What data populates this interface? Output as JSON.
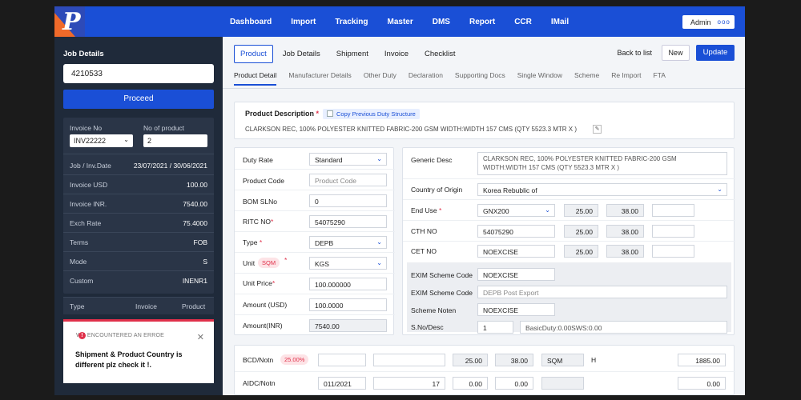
{
  "app": {
    "logo_letter": "P"
  },
  "nav": {
    "items": [
      "Dashboard",
      "Import",
      "Tracking",
      "Master",
      "DMS",
      "Report",
      "CCR",
      "IMail"
    ],
    "admin": "Admin",
    "admin_dots": "ooo"
  },
  "sidebar": {
    "title": "Job Details",
    "job_no": "4210533",
    "proceed": "Proceed",
    "invoice_no_label": "Invoice No",
    "no_of_product_label": "No of product",
    "invoice_no": "INV22222",
    "no_of_product": "2",
    "rows": [
      {
        "label": "Job / Inv.Date",
        "value": "23/07/2021  /  30/06/2021"
      },
      {
        "label": "Invoice  USD",
        "value": "100.00"
      },
      {
        "label": "Invoice INR.",
        "value": "7540.00"
      },
      {
        "label": "Exch Rate",
        "value": "75.4000"
      },
      {
        "label": "Terms",
        "value": "FOB"
      },
      {
        "label": "Mode",
        "value": "S"
      },
      {
        "label": "Custom",
        "value": "INENR1"
      }
    ],
    "type_headers": [
      "Type",
      "Invoice",
      "Product"
    ],
    "alert": {
      "title": "WE ENCOUNTERED AN ERROE",
      "message": "Shipment & Product Country is different plz check it !.",
      "icon": "!",
      "close": "✕"
    }
  },
  "tabs": [
    "Product",
    "Job Details",
    "Shipment",
    "Invoice",
    "Checklist"
  ],
  "actions": {
    "back": "Back to list",
    "new": "New",
    "update": "Update"
  },
  "subtabs": [
    "Product Detail",
    "Manufacturer Details",
    "Other Duty",
    "Declaration",
    "Supporting Docs",
    "Single Window",
    "Scheme",
    "Re Import",
    "FTA"
  ],
  "product": {
    "desc_label": "Product Description",
    "copy_label": "Copy Previous Duty Structure",
    "desc_text": "CLARKSON REC, 100% POLYESTER KNITTED FABRIC-200 GSM WIDTH:WIDTH 157 CMS (QTY 5523.3 MTR X )",
    "edit_icon": "✎"
  },
  "left_form": {
    "duty_rate_label": "Duty Rate",
    "duty_rate": "Standard",
    "product_code_label": "Product Code",
    "product_code_ph": "Product Code",
    "bom_label": "BOM SLNo",
    "bom": "0",
    "ritc_label": "RITC NO",
    "ritc": "54075290",
    "type_label": "Type",
    "type": "DEPB",
    "unit_label": "Unit",
    "unit_badge": "SQM",
    "unit": "KGS",
    "unit_price_label": "Unit Price",
    "unit_price": "100.000000",
    "amount_usd_label": "Amount (USD)",
    "amount_usd": "100.0000",
    "amount_inr_label": "Amount(INR)",
    "amount_inr": "7540.00"
  },
  "right_form": {
    "generic_label": "Generic Desc",
    "generic": "CLARKSON REC, 100% POLYESTER KNITTED FABRIC-200 GSM WIDTH:WIDTH 157 CMS (QTY 5523.3 MTR X )",
    "country_label": "Country of Origin",
    "country": "Korea Rebublic of",
    "end_use_label": "End Use",
    "end_use": "GNX200",
    "end_use_v1": "25.00",
    "end_use_v2": "38.00",
    "cth_label": "CTH NO",
    "cth": "54075290",
    "cth_v1": "25.00",
    "cth_v2": "38.00",
    "cet_label": "CET NO",
    "cet": "NOEXCISE",
    "cet_v1": "25.00",
    "cet_v2": "38.00",
    "exim1_label": "EXIM Scheme Code",
    "exim1": "NOEXCISE",
    "exim2_label": "EXIM Scheme Code",
    "exim2": "DEPB Post Export",
    "scheme_label": "Scheme Noten",
    "scheme": "NOEXCISE",
    "sno_label": "S.No/Desc",
    "sno": "1",
    "sno_desc": "BasicDuty:0.00SWS:0.00"
  },
  "duty": {
    "bcd_label": "BCD/Notn",
    "bcd_badge": "25.00%",
    "bcd_v1": "25.00",
    "bcd_v2": "38.00",
    "bcd_unit": "SQM",
    "bcd_h": "H",
    "bcd_total": "1885.00",
    "aidc_label": "AIDC/Notn",
    "aidc_notn": "011/2021",
    "aidc_v0": "17",
    "aidc_v1": "0.00",
    "aidc_v2": "0.00",
    "aidc_total": "0.00"
  },
  "colors": {
    "primary": "#1a4fd6",
    "sidebar": "#1f2a3a",
    "error": "#e0304a",
    "logo_accent": "#f06a2a"
  }
}
